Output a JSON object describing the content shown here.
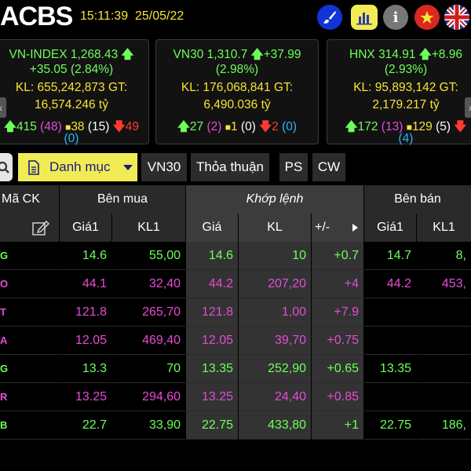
{
  "header": {
    "logo": "ACBS",
    "time": "15:11:39",
    "date": "25/05/22",
    "icons": [
      "brush-icon",
      "chart-icon",
      "info-icon",
      "vietnam-flag-icon",
      "uk-flag-icon"
    ],
    "info_glyph": "i"
  },
  "indices": [
    {
      "name": "VN-INDEX",
      "value": "1,268.43",
      "change": "+35.05",
      "percent": "(2.84%)",
      "kl_label": "KL:",
      "volume": "655,242,873",
      "gt_label": "GT:",
      "turnover": "16,574.246 tỷ",
      "up": "415",
      "ceiling": "(48)",
      "ref": "38",
      "ref_paren": "(15)",
      "down": "49",
      "floor": "(0)"
    },
    {
      "name": "VN30",
      "value": "1,310.7",
      "change": "+37.99",
      "percent": "(2.98%)",
      "kl_label": "KL:",
      "volume": "176,068,841",
      "gt_label": "GT:",
      "turnover": "6,490.036 tỷ",
      "up": "27",
      "ceiling": "(2)",
      "ref": "1",
      "ref_paren": "(0)",
      "down": "2",
      "floor": "(0)"
    },
    {
      "name": "HNX",
      "value": "314.91",
      "change": "+8.96",
      "percent": "(2.93%)",
      "kl_label": "KL:",
      "volume": "95,893,142",
      "gt_label": "GT:",
      "turnover": "2,179.217 tỷ",
      "up": "172",
      "ceiling": "(13)",
      "ref": "129",
      "ref_paren": "(5)",
      "down": "",
      "floor": "(4)"
    }
  ],
  "tabs": {
    "main": "Danh mục",
    "items": [
      "VN30",
      "Thỏa thuận",
      "PS",
      "CW"
    ]
  },
  "table": {
    "groups": {
      "symbol": "Mã CK",
      "buy": "Bên mua",
      "match": "Khớp lệnh",
      "sell": "Bên bán"
    },
    "columns": {
      "buy_price": "Giá1",
      "buy_vol": "KL1",
      "price": "Giá",
      "vol": "KL",
      "change": "+/-",
      "sell_price": "Giá1",
      "sell_vol": "KL1"
    },
    "rows": [
      {
        "sym": "G",
        "bp": "14.6",
        "bv": "55,00",
        "p": "14.6",
        "v": "10",
        "c": "+0.7",
        "sp": "14.7",
        "sv": "8,",
        "color": "green"
      },
      {
        "sym": "O",
        "bp": "44.1",
        "bv": "32,40",
        "p": "44.2",
        "v": "207,20",
        "c": "+4",
        "sp": "44.2",
        "sv": "453,",
        "color": "purple"
      },
      {
        "sym": "T",
        "bp": "121.8",
        "bv": "265,70",
        "p": "121.8",
        "v": "1,00",
        "c": "+7.9",
        "sp": "",
        "sv": "",
        "color": "purple"
      },
      {
        "sym": "A",
        "bp": "12.05",
        "bv": "469,40",
        "p": "12.05",
        "v": "39,70",
        "c": "+0.75",
        "sp": "",
        "sv": "",
        "color": "purple"
      },
      {
        "sym": "G",
        "bp": "13.3",
        "bv": "70",
        "p": "13.35",
        "v": "252,90",
        "c": "+0.65",
        "sp": "13.35",
        "sv": "",
        "color": "green"
      },
      {
        "sym": "R",
        "bp": "13.25",
        "bv": "294,60",
        "p": "13.25",
        "v": "24,40",
        "c": "+0.85",
        "sp": "",
        "sv": "",
        "color": "purple"
      },
      {
        "sym": "B",
        "bp": "22.7",
        "bv": "33,90",
        "p": "22.75",
        "v": "433,80",
        "c": "+1",
        "sp": "22.75",
        "sv": "186,",
        "color": "green"
      }
    ]
  },
  "colors": {
    "yellow": "#f7e533",
    "green": "#6dff5a",
    "purple": "#e64bd8",
    "red": "#ff3b30",
    "blue": "#28b5ff",
    "tab_active": "#f1ec55"
  }
}
